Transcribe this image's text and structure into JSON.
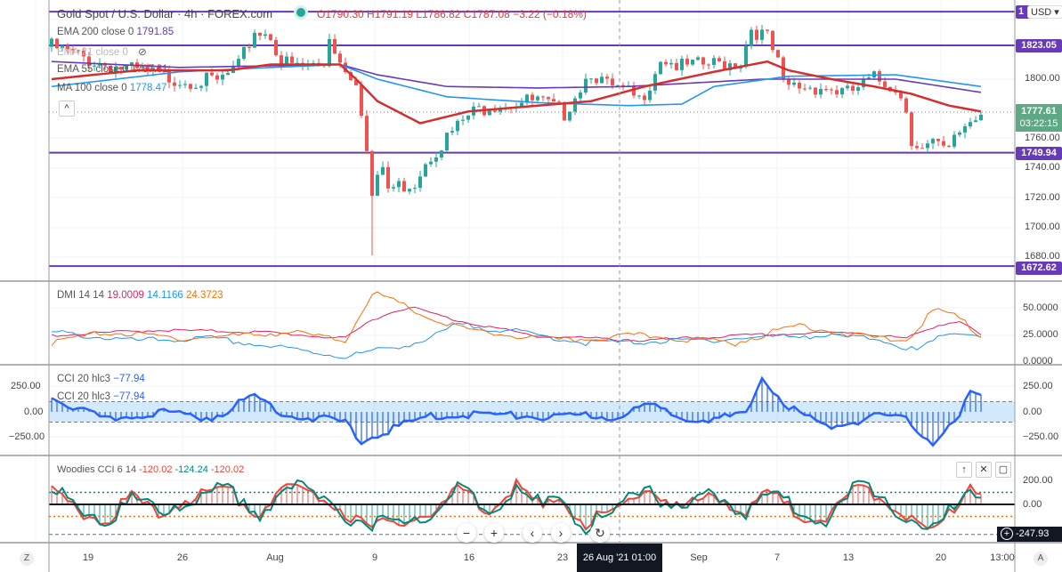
{
  "header": {
    "symbol": "Gold Spot / U.S. Dollar · 4h · FOREX.com",
    "ohlc": "O1790.30 H1791.19 L1786.82 C1787.08 −3.22 (−0.18%)",
    "currency": "USD"
  },
  "legend": {
    "ema200": {
      "label": "EMA 200 close 0",
      "value": "1791.85"
    },
    "ema21": {
      "label": "EMA 21 close 0"
    },
    "ema55": {
      "label": "EMA 55 close 0",
      "value": "1787.61"
    },
    "ma100": {
      "label": "MA 100 close 0",
      "value": "1778.47"
    },
    "dmi": {
      "label": "DMI 14 14",
      "v1": "19.0009",
      "v2": "14.1166",
      "v3": "24.3723"
    },
    "cci1": {
      "label": "CCI 20 hlc3",
      "value": "−77.94"
    },
    "cci2": {
      "label": "CCI 20 hlc3",
      "value": "−77.94"
    },
    "woodies": {
      "label": "Woodies CCI 6 14",
      "v1": "-120.02",
      "v2": "-124.24",
      "v3": "-120.02"
    }
  },
  "price_axis": {
    "ticks": [
      "1800.00",
      "1760.00",
      "1740.00",
      "1720.00",
      "1700.00",
      "1680.00"
    ],
    "levels": [
      "1823.05",
      "1749.94",
      "1672.62",
      "1"
    ],
    "last_price": "1777.61",
    "countdown": "03:22:15"
  },
  "dmi_axis": [
    "50.0000",
    "25.0000",
    "0.0000"
  ],
  "cci_axis": [
    "250.00",
    "0.00",
    "−250.00"
  ],
  "woodies_axis": {
    "ticks": [
      "200.00",
      "0.00"
    ],
    "cursor": "-247.93"
  },
  "time_axis": {
    "labels": [
      "19",
      "26",
      "Aug",
      "9",
      "16",
      "23",
      "Sep",
      "7",
      "13",
      "20",
      "13:00"
    ],
    "crosshair": "26 Aug '21   01:00",
    "left_btn": "Z",
    "right_btn": "A"
  },
  "controls": {
    "zoom_out": "−",
    "zoom_in": "+",
    "prev": "‹",
    "next": "›",
    "reset": "↻",
    "up": "↑",
    "close": "✕",
    "max": "▢",
    "collapse": "^",
    "add": "+"
  },
  "colors": {
    "up": "#26a69a",
    "down": "#ef5350",
    "ema55": "#d32f2f",
    "ema200": "#673ab7",
    "ma100": "#2196f3",
    "level": "#673ab7"
  },
  "chart_data": {
    "type": "candlestick",
    "title": "Gold Spot / U.S. Dollar 4h",
    "price_range": [
      1660,
      1850
    ],
    "levels": [
      1846,
      1823.05,
      1749.94,
      1672.62
    ],
    "price_keypoints": [
      [
        0,
        1822
      ],
      [
        8,
        1812
      ],
      [
        16,
        1805
      ],
      [
        24,
        1800
      ],
      [
        31,
        1798
      ],
      [
        35,
        1808
      ],
      [
        38,
        1833
      ],
      [
        41,
        1830
      ],
      [
        43,
        1812
      ],
      [
        46,
        1808
      ],
      [
        51,
        1810
      ],
      [
        52,
        1830
      ],
      [
        54,
        1812
      ],
      [
        57,
        1800
      ],
      [
        58,
        1780
      ],
      [
        59,
        1750
      ],
      [
        60,
        1720
      ],
      [
        62,
        1740
      ],
      [
        63,
        1725
      ],
      [
        68,
        1730
      ],
      [
        70,
        1745
      ],
      [
        74,
        1760
      ],
      [
        78,
        1775
      ],
      [
        82,
        1783
      ],
      [
        91,
        1785
      ],
      [
        96,
        1777
      ],
      [
        98,
        1790
      ],
      [
        101,
        1806
      ],
      [
        104,
        1795
      ],
      [
        108,
        1790
      ],
      [
        110,
        1785
      ],
      [
        112,
        1798
      ],
      [
        114,
        1815
      ],
      [
        118,
        1808
      ],
      [
        124,
        1810
      ],
      [
        129,
        1812
      ],
      [
        131,
        1835
      ],
      [
        134,
        1828
      ],
      [
        136,
        1810
      ],
      [
        137,
        1795
      ],
      [
        144,
        1795
      ],
      [
        149,
        1790
      ],
      [
        154,
        1800
      ],
      [
        158,
        1795
      ],
      [
        160,
        1780
      ],
      [
        161,
        1760
      ],
      [
        163,
        1752
      ],
      [
        165,
        1755
      ],
      [
        168,
        1750
      ],
      [
        169,
        1762
      ],
      [
        172,
        1772
      ],
      [
        174,
        1778
      ]
    ],
    "ema55": [
      [
        0,
        1800
      ],
      [
        16,
        1806
      ],
      [
        33,
        1806
      ],
      [
        41,
        1810
      ],
      [
        54,
        1810
      ],
      [
        57,
        1800
      ],
      [
        61,
        1785
      ],
      [
        69,
        1770
      ],
      [
        78,
        1778
      ],
      [
        91,
        1782
      ],
      [
        101,
        1785
      ],
      [
        111,
        1795
      ],
      [
        124,
        1805
      ],
      [
        134,
        1812
      ],
      [
        138,
        1806
      ],
      [
        146,
        1800
      ],
      [
        154,
        1795
      ],
      [
        161,
        1790
      ],
      [
        168,
        1782
      ],
      [
        174,
        1778
      ]
    ],
    "ema200": [
      [
        0,
        1812
      ],
      [
        24,
        1808
      ],
      [
        54,
        1810
      ],
      [
        61,
        1803
      ],
      [
        74,
        1795
      ],
      [
        91,
        1794
      ],
      [
        108,
        1795
      ],
      [
        133,
        1800
      ],
      [
        158,
        1800
      ],
      [
        174,
        1791
      ]
    ],
    "ma100": [
      [
        0,
        1795
      ],
      [
        24,
        1805
      ],
      [
        41,
        1808
      ],
      [
        54,
        1810
      ],
      [
        61,
        1800
      ],
      [
        74,
        1788
      ],
      [
        91,
        1784
      ],
      [
        108,
        1782
      ],
      [
        118,
        1783
      ],
      [
        124,
        1795
      ],
      [
        138,
        1802
      ],
      [
        158,
        1803
      ],
      [
        174,
        1795
      ]
    ],
    "dmi_plus": [
      [
        0,
        25
      ],
      [
        20,
        30
      ],
      [
        40,
        28
      ],
      [
        55,
        22
      ],
      [
        60,
        40
      ],
      [
        67,
        52
      ],
      [
        75,
        40
      ],
      [
        90,
        25
      ],
      [
        110,
        20
      ],
      [
        130,
        25
      ],
      [
        150,
        28
      ],
      [
        160,
        22
      ],
      [
        166,
        35
      ],
      [
        170,
        38
      ],
      [
        174,
        25
      ]
    ],
    "dmi_minus": [
      [
        0,
        28
      ],
      [
        15,
        20
      ],
      [
        30,
        22
      ],
      [
        45,
        12
      ],
      [
        55,
        5
      ],
      [
        60,
        10
      ],
      [
        70,
        20
      ],
      [
        76,
        35
      ],
      [
        85,
        30
      ],
      [
        100,
        18
      ],
      [
        120,
        20
      ],
      [
        140,
        25
      ],
      [
        155,
        22
      ],
      [
        162,
        10
      ],
      [
        168,
        28
      ],
      [
        174,
        25
      ]
    ],
    "adx": [
      [
        0,
        18
      ],
      [
        10,
        28
      ],
      [
        25,
        22
      ],
      [
        45,
        28
      ],
      [
        55,
        20
      ],
      [
        60,
        65
      ],
      [
        65,
        55
      ],
      [
        72,
        38
      ],
      [
        80,
        28
      ],
      [
        95,
        20
      ],
      [
        110,
        25
      ],
      [
        128,
        18
      ],
      [
        140,
        35
      ],
      [
        150,
        25
      ],
      [
        160,
        20
      ],
      [
        165,
        48
      ],
      [
        169,
        45
      ],
      [
        174,
        24
      ]
    ],
    "cci": [
      [
        0,
        150
      ],
      [
        4,
        50
      ],
      [
        10,
        -80
      ],
      [
        20,
        0
      ],
      [
        30,
        -60
      ],
      [
        38,
        160
      ],
      [
        44,
        -30
      ],
      [
        55,
        -100
      ],
      [
        58,
        -300
      ],
      [
        62,
        -200
      ],
      [
        70,
        -50
      ],
      [
        80,
        -20
      ],
      [
        95,
        -60
      ],
      [
        100,
        -30
      ],
      [
        105,
        -60
      ],
      [
        110,
        40
      ],
      [
        113,
        50
      ],
      [
        118,
        -50
      ],
      [
        124,
        -70
      ],
      [
        130,
        -30
      ],
      [
        133,
        330
      ],
      [
        138,
        50
      ],
      [
        145,
        -150
      ],
      [
        155,
        -40
      ],
      [
        160,
        -80
      ],
      [
        165,
        -300
      ],
      [
        170,
        -50
      ],
      [
        172,
        200
      ],
      [
        174,
        130
      ]
    ],
    "woodies": [
      [
        0,
        100
      ],
      [
        5,
        -50
      ],
      [
        10,
        -150
      ],
      [
        15,
        80
      ],
      [
        20,
        -100
      ],
      [
        25,
        50
      ],
      [
        33,
        130
      ],
      [
        38,
        -80
      ],
      [
        45,
        150
      ],
      [
        52,
        30
      ],
      [
        56,
        -100
      ],
      [
        60,
        -200
      ],
      [
        66,
        -120
      ],
      [
        72,
        -80
      ],
      [
        76,
        150
      ],
      [
        82,
        -50
      ],
      [
        87,
        180
      ],
      [
        92,
        -50
      ],
      [
        95,
        60
      ],
      [
        100,
        -150
      ],
      [
        106,
        -50
      ],
      [
        112,
        150
      ],
      [
        118,
        -50
      ],
      [
        124,
        100
      ],
      [
        130,
        -80
      ],
      [
        134,
        120
      ],
      [
        140,
        -100
      ],
      [
        146,
        -100
      ],
      [
        150,
        130
      ],
      [
        155,
        80
      ],
      [
        160,
        -100
      ],
      [
        165,
        -250
      ],
      [
        170,
        50
      ],
      [
        172,
        180
      ],
      [
        174,
        90
      ]
    ]
  }
}
